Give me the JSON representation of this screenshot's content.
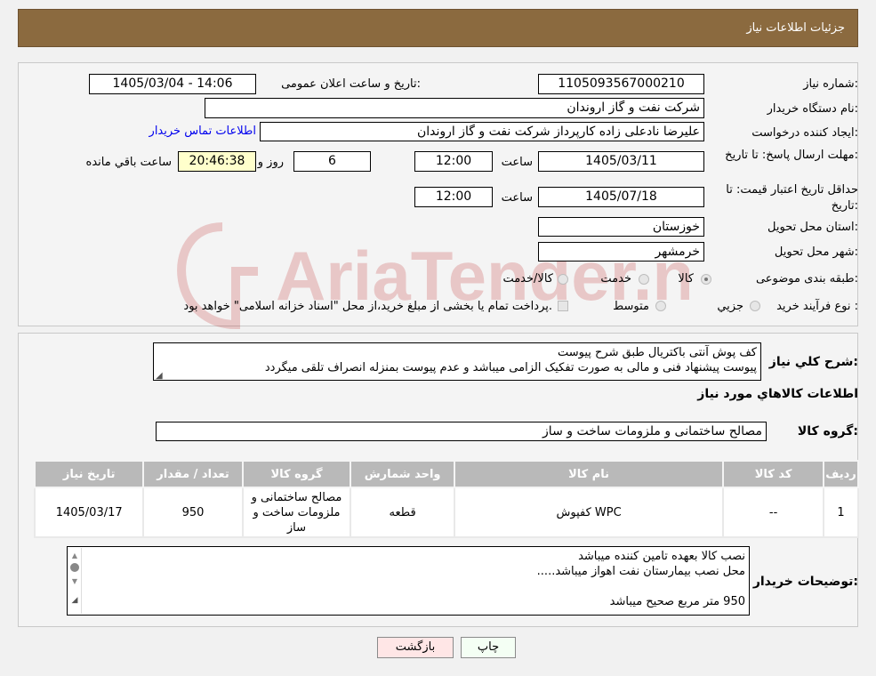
{
  "header": {
    "title": "جزئیات اطلاعات نیاز"
  },
  "watermark": {
    "text": "AriaTender.neT"
  },
  "form": {
    "need_number_label": "شماره نیاز:",
    "need_number": "1105093567000210",
    "announce_label": "تاریخ و ساعت اعلان عمومی:",
    "announce_value": "1405/03/04 - 14:06",
    "buyer_org_label": "نام دستگاه خریدار:",
    "buyer_org": "شرکت نفت و گاز اروندان",
    "creator_label": "ایجاد کننده درخواست:",
    "creator": "علیرضا نادعلی زاده کارپرداز شرکت نفت و گاز اروندان",
    "contact_link": "اطلاعات تماس خریدار",
    "deadline_label": "مهلت ارسال پاسخ: تا تاریخ:",
    "deadline_date": "1405/03/11",
    "time_label": "ساعت",
    "deadline_time": "12:00",
    "days_value": "6",
    "days_label": "روز و",
    "remaining_value": "20:46:38",
    "remaining_label": "ساعت باقي مانده",
    "validity_label": "حداقل تاریخ اعتبار قیمت: تا تاریخ:",
    "validity_date": "1405/07/18",
    "validity_time": "12:00",
    "province_label": "استان محل تحویل:",
    "province": "خوزستان",
    "city_label": "شهر محل تحویل:",
    "city": "خرمشهر",
    "category_label": "طبقه بندی موضوعی:",
    "category_options": [
      "کالا",
      "خدمت",
      "کالا/خدمت"
    ],
    "category_selected": "کالا",
    "process_label": "نوع فرآیند خرید :",
    "process_options": [
      "جزيي",
      "متوسط"
    ],
    "process_note": "پرداخت تمام یا بخشی از مبلغ خرید،از محل \"اسناد خزانه اسلامی\" خواهد بود."
  },
  "summary": {
    "label": "شرح كلي نياز:",
    "lines": [
      "کف پوش آنتی باکتریال طبق شرح پیوست",
      "پیوست پیشنهاد فنی و مالی به صورت تفکیک الزامی میباشد و عدم پیوست بمنزله انصراف تلقی میگردد"
    ]
  },
  "goods": {
    "section_title": "اطلاعات كالاهاي مورد نياز",
    "group_label": "گروه كالا:",
    "group_value": "مصالح ساختمانی و ملزومات ساخت و ساز",
    "columns": [
      "رديف",
      "كد كالا",
      "نام كالا",
      "واحد شمارش",
      "گروه كالا",
      "تعداد / مقدار",
      "تاريخ نياز"
    ],
    "rows": [
      {
        "row": "1",
        "code": "--",
        "name": "کفپوش WPC",
        "unit": "قطعه",
        "group": "مصالح ساختمانی و ملزومات ساخت و ساز",
        "qty": "950",
        "date": "1405/03/17"
      }
    ]
  },
  "buyer_notes": {
    "label": "توضيحات خريدار:",
    "lines": [
      "نصب کالا بعهده تامین کننده میباشد",
      "محل نصب بیمارستان نفت اهواز میباشد.....",
      "",
      "950 متر مربع صحیح میباشد"
    ]
  },
  "buttons": {
    "print": "چاپ",
    "back": "بازگشت"
  }
}
